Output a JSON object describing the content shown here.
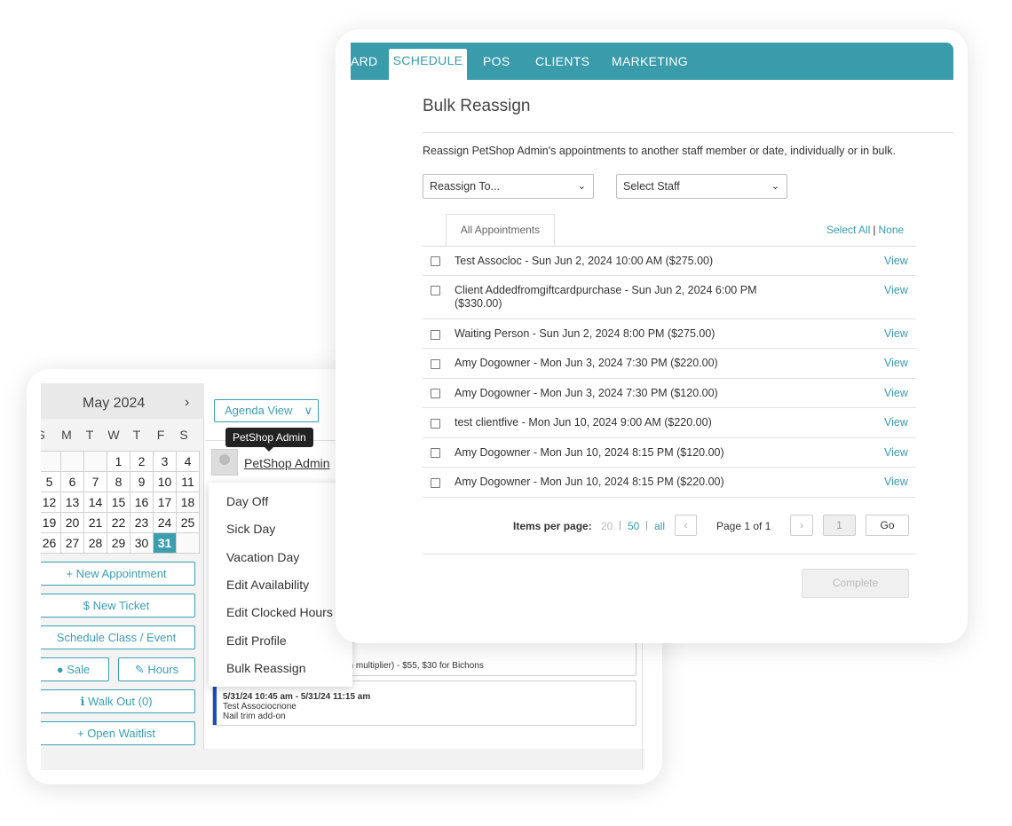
{
  "calendar": {
    "month_title": "May 2024",
    "next_icon": "chevron-right-icon",
    "days_of_week": [
      "S",
      "M",
      "T",
      "W",
      "T",
      "F",
      "S"
    ],
    "weeks": [
      [
        "",
        "",
        "",
        "1",
        "2",
        "3",
        "4"
      ],
      [
        "5",
        "6",
        "7",
        "8",
        "9",
        "10",
        "11"
      ],
      [
        "12",
        "13",
        "14",
        "15",
        "16",
        "17",
        "18"
      ],
      [
        "19",
        "20",
        "21",
        "22",
        "23",
        "24",
        "25"
      ],
      [
        "26",
        "27",
        "28",
        "29",
        "30",
        "31",
        ""
      ]
    ],
    "selected_day": "31"
  },
  "sidebar_buttons": {
    "new_appointment": "+ New Appointment",
    "new_ticket": "$  New Ticket",
    "schedule_class": "Schedule Class / Event",
    "sale": "Sale",
    "hours": "Hours",
    "walk_out": "Walk Out (0)",
    "open_waitlist": "+ Open Waitlist"
  },
  "agenda": {
    "view_label": "Agenda View",
    "tooltip": "PetShop Admin",
    "staff_name": "PetShop Admin"
  },
  "staff_menu": {
    "items": [
      "Day Off",
      "Sick Day",
      "Vacation Day",
      "Edit Availability",
      "Edit Clocked Hours",
      "Edit Profile",
      "Bulk Reassign"
    ]
  },
  "appointments": {
    "partial_line": "ic (with multiplier) - $55, $30 for Bichons",
    "card2_time": "5/31/24 10:45 am - 5/31/24 11:15 am",
    "card2_client": "Test Associocnone",
    "card2_service": "Nail trim add-on"
  },
  "nav": {
    "items": [
      "ARD",
      "SCHEDULE",
      "POS",
      "CLIENTS",
      "MARKETING"
    ],
    "active": "SCHEDULE"
  },
  "bulk": {
    "title": "Bulk Reassign",
    "description": "Reassign PetShop Admin's appointments to another staff member or date, individually or in bulk.",
    "reassign_select": "Reassign To...",
    "staff_select": "Select Staff",
    "tab_label": "All Appointments",
    "select_all": "Select All",
    "select_none": "None",
    "view_label": "View",
    "rows": [
      {
        "line1": "Test Assocloc - Sun Jun 2, 2024 10:00 AM ($275.00)",
        "line2": ""
      },
      {
        "line1": "Client Addedfromgiftcardpurchase - Sun Jun 2, 2024 6:00 PM",
        "line2": "($330.00)"
      },
      {
        "line1": "Waiting Person - Sun Jun 2, 2024 8:00 PM ($275.00)",
        "line2": ""
      },
      {
        "line1": "Amy Dogowner - Mon Jun 3, 2024 7:30 PM ($220.00)",
        "line2": ""
      },
      {
        "line1": "Amy Dogowner - Mon Jun 3, 2024 7:30 PM ($120.00)",
        "line2": ""
      },
      {
        "line1": "test clientfive - Mon Jun 10, 2024 9:00 AM ($220.00)",
        "line2": ""
      },
      {
        "line1": "Amy Dogowner - Mon Jun 10, 2024 8:15 PM ($120.00)",
        "line2": ""
      },
      {
        "line1": "Amy Dogowner - Mon Jun 10, 2024 8:15 PM ($220.00)",
        "line2": ""
      }
    ],
    "pager": {
      "label": "Items per page:",
      "options": [
        "20",
        "50",
        "all"
      ],
      "page_info": "Page 1 of 1",
      "page_input": "1",
      "go": "Go",
      "prev_icon": "chevron-left-icon",
      "next_icon": "chevron-right-icon"
    },
    "complete": "Complete"
  },
  "colors": {
    "accent": "#3a9bab",
    "today": "#3b9fb0",
    "appointment_bar": "#1a4fc4"
  }
}
